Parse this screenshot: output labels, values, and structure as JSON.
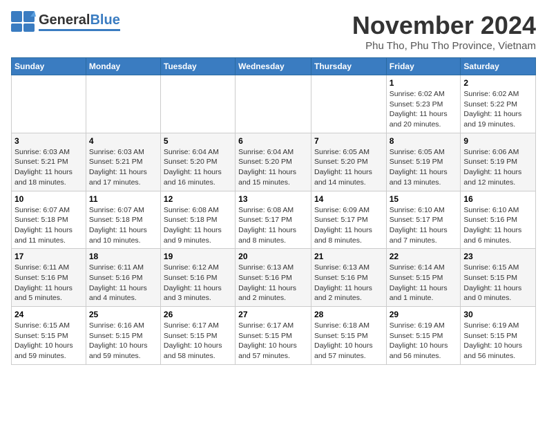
{
  "logo": {
    "general": "General",
    "blue": "Blue"
  },
  "title": "November 2024",
  "location": "Phu Tho, Phu Tho Province, Vietnam",
  "days_of_week": [
    "Sunday",
    "Monday",
    "Tuesday",
    "Wednesday",
    "Thursday",
    "Friday",
    "Saturday"
  ],
  "weeks": [
    [
      {
        "day": "",
        "info": ""
      },
      {
        "day": "",
        "info": ""
      },
      {
        "day": "",
        "info": ""
      },
      {
        "day": "",
        "info": ""
      },
      {
        "day": "",
        "info": ""
      },
      {
        "day": "1",
        "info": "Sunrise: 6:02 AM\nSunset: 5:23 PM\nDaylight: 11 hours and 20 minutes."
      },
      {
        "day": "2",
        "info": "Sunrise: 6:02 AM\nSunset: 5:22 PM\nDaylight: 11 hours and 19 minutes."
      }
    ],
    [
      {
        "day": "3",
        "info": "Sunrise: 6:03 AM\nSunset: 5:21 PM\nDaylight: 11 hours and 18 minutes."
      },
      {
        "day": "4",
        "info": "Sunrise: 6:03 AM\nSunset: 5:21 PM\nDaylight: 11 hours and 17 minutes."
      },
      {
        "day": "5",
        "info": "Sunrise: 6:04 AM\nSunset: 5:20 PM\nDaylight: 11 hours and 16 minutes."
      },
      {
        "day": "6",
        "info": "Sunrise: 6:04 AM\nSunset: 5:20 PM\nDaylight: 11 hours and 15 minutes."
      },
      {
        "day": "7",
        "info": "Sunrise: 6:05 AM\nSunset: 5:20 PM\nDaylight: 11 hours and 14 minutes."
      },
      {
        "day": "8",
        "info": "Sunrise: 6:05 AM\nSunset: 5:19 PM\nDaylight: 11 hours and 13 minutes."
      },
      {
        "day": "9",
        "info": "Sunrise: 6:06 AM\nSunset: 5:19 PM\nDaylight: 11 hours and 12 minutes."
      }
    ],
    [
      {
        "day": "10",
        "info": "Sunrise: 6:07 AM\nSunset: 5:18 PM\nDaylight: 11 hours and 11 minutes."
      },
      {
        "day": "11",
        "info": "Sunrise: 6:07 AM\nSunset: 5:18 PM\nDaylight: 11 hours and 10 minutes."
      },
      {
        "day": "12",
        "info": "Sunrise: 6:08 AM\nSunset: 5:18 PM\nDaylight: 11 hours and 9 minutes."
      },
      {
        "day": "13",
        "info": "Sunrise: 6:08 AM\nSunset: 5:17 PM\nDaylight: 11 hours and 8 minutes."
      },
      {
        "day": "14",
        "info": "Sunrise: 6:09 AM\nSunset: 5:17 PM\nDaylight: 11 hours and 8 minutes."
      },
      {
        "day": "15",
        "info": "Sunrise: 6:10 AM\nSunset: 5:17 PM\nDaylight: 11 hours and 7 minutes."
      },
      {
        "day": "16",
        "info": "Sunrise: 6:10 AM\nSunset: 5:16 PM\nDaylight: 11 hours and 6 minutes."
      }
    ],
    [
      {
        "day": "17",
        "info": "Sunrise: 6:11 AM\nSunset: 5:16 PM\nDaylight: 11 hours and 5 minutes."
      },
      {
        "day": "18",
        "info": "Sunrise: 6:11 AM\nSunset: 5:16 PM\nDaylight: 11 hours and 4 minutes."
      },
      {
        "day": "19",
        "info": "Sunrise: 6:12 AM\nSunset: 5:16 PM\nDaylight: 11 hours and 3 minutes."
      },
      {
        "day": "20",
        "info": "Sunrise: 6:13 AM\nSunset: 5:16 PM\nDaylight: 11 hours and 2 minutes."
      },
      {
        "day": "21",
        "info": "Sunrise: 6:13 AM\nSunset: 5:16 PM\nDaylight: 11 hours and 2 minutes."
      },
      {
        "day": "22",
        "info": "Sunrise: 6:14 AM\nSunset: 5:15 PM\nDaylight: 11 hours and 1 minute."
      },
      {
        "day": "23",
        "info": "Sunrise: 6:15 AM\nSunset: 5:15 PM\nDaylight: 11 hours and 0 minutes."
      }
    ],
    [
      {
        "day": "24",
        "info": "Sunrise: 6:15 AM\nSunset: 5:15 PM\nDaylight: 10 hours and 59 minutes."
      },
      {
        "day": "25",
        "info": "Sunrise: 6:16 AM\nSunset: 5:15 PM\nDaylight: 10 hours and 59 minutes."
      },
      {
        "day": "26",
        "info": "Sunrise: 6:17 AM\nSunset: 5:15 PM\nDaylight: 10 hours and 58 minutes."
      },
      {
        "day": "27",
        "info": "Sunrise: 6:17 AM\nSunset: 5:15 PM\nDaylight: 10 hours and 57 minutes."
      },
      {
        "day": "28",
        "info": "Sunrise: 6:18 AM\nSunset: 5:15 PM\nDaylight: 10 hours and 57 minutes."
      },
      {
        "day": "29",
        "info": "Sunrise: 6:19 AM\nSunset: 5:15 PM\nDaylight: 10 hours and 56 minutes."
      },
      {
        "day": "30",
        "info": "Sunrise: 6:19 AM\nSunset: 5:15 PM\nDaylight: 10 hours and 56 minutes."
      }
    ]
  ]
}
